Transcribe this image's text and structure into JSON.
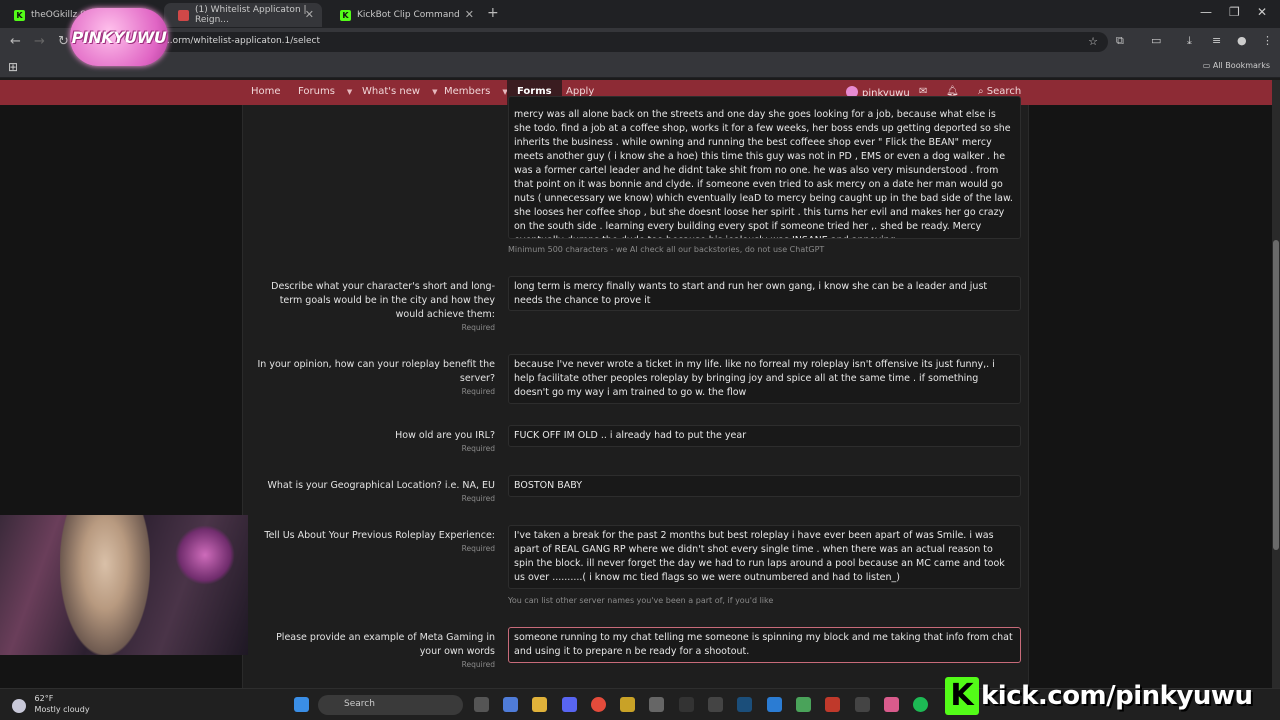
{
  "tabs": [
    {
      "title": "theOGkillz Stream - ..."
    },
    {
      "title": "(1) Whitelist Applicaton | Reign..."
    },
    {
      "title": "KickBot Clip Command"
    }
  ],
  "address": {
    "url": "...orm/whitelist-applicaton.1/select"
  },
  "bookmarks": {
    "all_label": "All Bookmarks"
  },
  "logo": {
    "text": "PINKYUWU"
  },
  "nav": {
    "items": [
      "Home",
      "Forums",
      "What's new",
      "Members",
      "Forms",
      "Apply"
    ],
    "user": "pinkyuwu",
    "search": "Search"
  },
  "form": {
    "backstory_answer": "mercy was all alone back on the streets and one day she goes looking for a job, because what else is she todo. find a job at a coffee shop, works it for a few weeks, her boss ends up getting deported so she inherits the business . while owning and running the best coffeee shop ever \" Flick the BEAN\" mercy meets another guy ( i know she a hoe) this time this guy was not in PD , EMS or even a dog walker . he was a former cartel leader and he didnt take shit from no one. he was also very misunderstood . from that point on it was bonnie and clyde. if someone even tried to ask mercy on a date her man would go nuts ( unnecessary we know) which eventually leaD to mercy being caught up in the bad side of the law. she looses her coffee shop , but she doesnt loose her spirit . this turns her evil and makes her go crazy on the south side . learning every building every spot if someone tried her ,. shed be ready. Mercy eventually dumps the dude too because his jealously was INSANE and annoying .",
    "backstory_hint": "Minimum 500 characters - we AI check all our backstories, do not use ChatGPT",
    "required_label": "Required",
    "questions": [
      {
        "label": "Describe what your character's short and long-term goals would be in the city and how they would achieve them:",
        "answer": "long term is mercy finally wants to start and run her own gang, i know she can be a leader and just needs the chance to prove it"
      },
      {
        "label": "In your opinion, how can your roleplay benefit the server?",
        "answer": "because I've never wrote a ticket in my life. like no forreal my roleplay isn't offensive its just funny,. i help facilitate other peoples roleplay by bringing joy and spice all at the same time . if something doesn't go my way i am trained to go w. the flow"
      },
      {
        "label": "How old are you IRL?",
        "answer": "FUCK OFF IM OLD .. i already had to put the year"
      },
      {
        "label": "What is your Geographical Location? i.e. NA, EU",
        "answer": "BOSTON BABY"
      },
      {
        "label": "Tell Us About Your Previous Roleplay Experience:",
        "answer": "I've taken a break for the past 2 months but best roleplay i have ever been apart of was Smile.  i was apart of REAL GANG RP where we didn't shot every single time . when there was an actual reason to spin the block. ill never forget the day we had to run laps around a pool because an MC came and took us over ..........( i know mc tied flags so we were outnumbered and had to listen_)",
        "hint": "You can list other server names you've been a part of, if you'd like"
      },
      {
        "label": "Please provide an example of Meta Gaming in your own words",
        "answer": "someone running to my chat telling me someone is spinning my block and me taking that info from chat and using it to prepare n be ready for a shootout."
      }
    ]
  },
  "taskbar": {
    "temp": "62°F",
    "weather": "Mostly cloudy",
    "search": "Search"
  },
  "stream": {
    "kick_domain": "kick.com/pinkyuwu"
  }
}
